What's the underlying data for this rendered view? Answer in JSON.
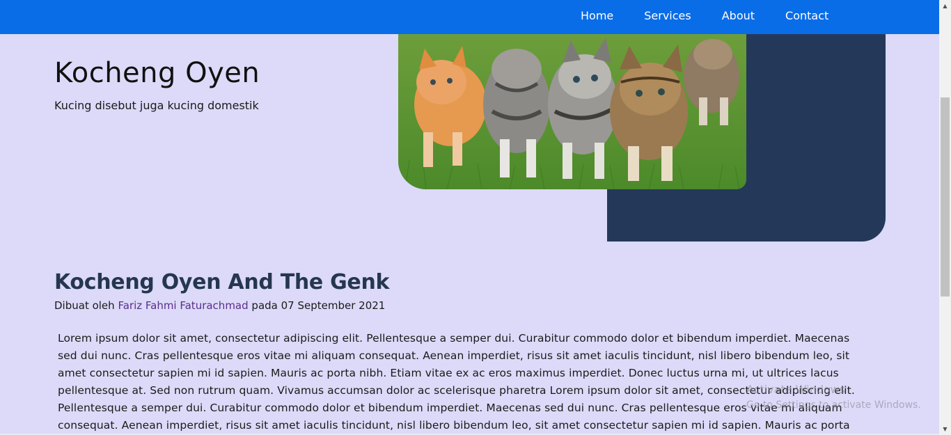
{
  "nav": {
    "items": [
      {
        "label": "Home"
      },
      {
        "label": "Services"
      },
      {
        "label": "About"
      },
      {
        "label": "Contact"
      }
    ]
  },
  "hero": {
    "title": "Kocheng Oyen",
    "subtitle": "Kucing disebut juga kucing domestik"
  },
  "article": {
    "title": "Kocheng Oyen And The Genk",
    "byline_prefix": "Dibuat oleh",
    "author": "Fariz Fahmi Faturachmad",
    "byline_suffix": "pada 07 September 2021",
    "body": "Lorem ipsum dolor sit amet, consectetur adipiscing elit. Pellentesque a semper dui. Curabitur commodo dolor et bibendum imperdiet. Maecenas sed dui nunc. Cras pellentesque eros vitae mi aliquam consequat. Aenean imperdiet, risus sit amet iaculis tincidunt, nisl libero bibendum leo, sit amet consectetur sapien mi id sapien. Mauris ac porta nibh. Etiam vitae ex ac eros maximus imperdiet. Donec luctus urna mi, ut ultrices lacus pellentesque at. Sed non rutrum quam. Vivamus accumsan dolor ac scelerisque pharetra Lorem ipsum dolor sit amet, consectetur adipiscing elit. Pellentesque a semper dui. Curabitur commodo dolor et bibendum imperdiet. Maecenas sed dui nunc. Cras pellentesque eros vitae mi aliquam consequat. Aenean imperdiet, risus sit amet iaculis tincidunt, nisl libero bibendum leo, sit amet consectetur sapien mi id sapien. Mauris ac porta"
  },
  "watermark": {
    "title": "Activate Windows",
    "subtitle": "Go to Settings to activate Windows."
  },
  "colors": {
    "navbar": "#0a6de8",
    "page_background": "#dcdaf8",
    "dark_block": "#243959",
    "article_title": "#25374f",
    "author_link": "#5a2d8c"
  },
  "icons": {
    "scroll_up": "triangle-up",
    "scroll_down": "triangle-down"
  }
}
